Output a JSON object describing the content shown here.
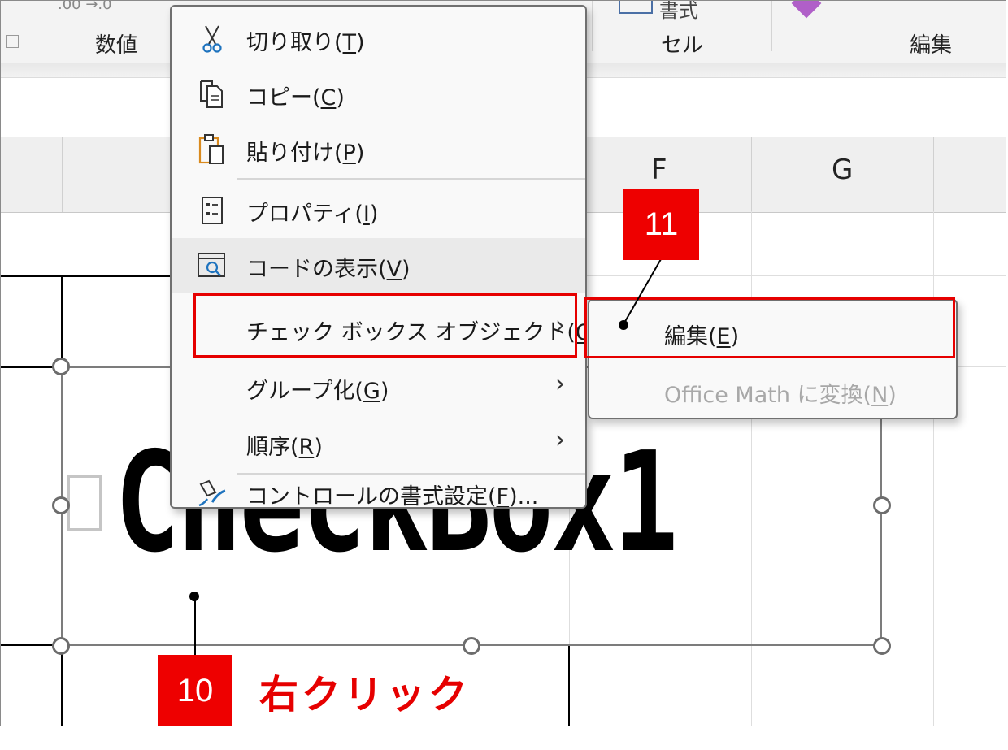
{
  "ribbon": {
    "fragment_left": ".00 →.0",
    "groups": {
      "number": "数値",
      "cells": "セル",
      "editing": "編集"
    },
    "fragment_cells": "書式"
  },
  "columns": [
    "F",
    "G"
  ],
  "checkbox": {
    "caption": "CheckBox1"
  },
  "context_menu": {
    "items": [
      {
        "label": "切り取り(",
        "key": "T",
        "icon": "scissors-icon"
      },
      {
        "label": "コピー(",
        "key": "C",
        "icon": "copy-icon"
      },
      {
        "label": "貼り付け(",
        "key": "P",
        "icon": "paste-icon"
      },
      {
        "label": "プロパティ(",
        "key": "I",
        "icon": "properties-icon"
      },
      {
        "label": "コードの表示(",
        "key": "V",
        "icon": "view-code-icon"
      },
      {
        "label": "チェック ボックス オブジェクト(",
        "key": "O",
        "submenu": true
      },
      {
        "label": "グループ化(",
        "key": "G",
        "submenu": true
      },
      {
        "label": "順序(",
        "key": "R",
        "submenu": true
      },
      {
        "label": "コントロールの書式設定(",
        "key": "F",
        "suffix": ")...",
        "icon": "format-control-icon"
      }
    ]
  },
  "submenu": {
    "items": [
      {
        "label": "編集(",
        "key": "E",
        "enabled": true
      },
      {
        "label": "Office Math に変換(",
        "key": "N",
        "enabled": false
      }
    ]
  },
  "callouts": {
    "step10": "10",
    "step10_text": "右クリック",
    "step11": "11"
  },
  "colors": {
    "highlight": "#e60000",
    "callout_bg": "#ee0000",
    "menu_bg": "#f9f9f9",
    "hover_bg": "#eaeaea"
  }
}
